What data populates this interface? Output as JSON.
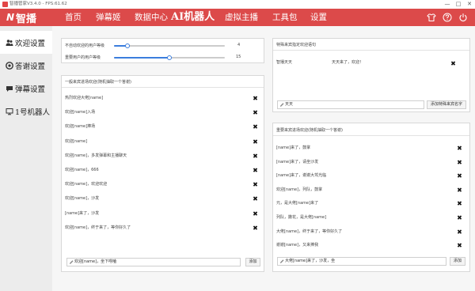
{
  "window": {
    "title": "智播管家V3.4.0 - FPS:61.62",
    "minimize_glyph": "—",
    "maximize_glyph": "□",
    "close_glyph": "✕"
  },
  "brand": {
    "mark": "N",
    "name": "智播"
  },
  "nav": {
    "items": [
      "首页",
      "弹幕姬",
      "数据中心",
      "AI机器人",
      "虚拟主播",
      "工具包",
      "设置"
    ],
    "icons": [
      "shirt-icon",
      "help-icon",
      "power-icon"
    ]
  },
  "sidebar": {
    "items": [
      {
        "label": "欢迎设置",
        "icon": "people-icon"
      },
      {
        "label": "答谢设置",
        "icon": "thanks-icon"
      },
      {
        "label": "弹幕设置",
        "icon": "barrage-icon"
      },
      {
        "label": "1号机器人",
        "icon": "monitor-icon"
      }
    ]
  },
  "settings": {
    "no_welcome_level_label": "不自动欢迎的用户等级",
    "no_welcome_level_value": "4",
    "no_welcome_level_fraction": 0.12,
    "vip_level_label": "重要用户的用户等级",
    "vip_level_value": "15",
    "vip_level_fraction": 0.5
  },
  "general_welcome": {
    "header": "一般来宾进场欢迎(随机抽取一个答谢)",
    "rows": [
      "热烈欢迎大佬[name]",
      "欢迎[name]入场",
      "欢迎[name]捧场",
      "欢迎[name]",
      "欢迎[name]，多发弹幕和主播聊天",
      "欢迎[name]，666",
      "欢迎[name]，欢迎欢迎",
      "欢迎[name]，沙发",
      "[name]来了，沙发",
      "欢迎[name]，终于来了，等你好久了"
    ],
    "input_value": "欢迎[name]，坐下唠嗑",
    "add_label": "添加"
  },
  "specific_welcome": {
    "header": "特殊来宾指定欢迎语句",
    "rows": [
      {
        "name": "智播天天",
        "text": "天天来了，欢迎！"
      }
    ],
    "input_value": "天天",
    "add_label": "添加特殊来宾名字"
  },
  "vip_welcome": {
    "header": "重要来宾进场欢迎(随机抽取一个答谢)",
    "rows": [
      "[name]来了，鼓掌",
      "[name]来了，请坐沙发",
      "[name]来了，谢谢大驾光临",
      "欢迎[name]，列队，鼓掌",
      "元，是大佬[name]来了",
      "列队，撒花，是大佬[name]",
      "大佬[name]，终于来了，等你好久了",
      "谢谢[name]，又来捧我"
    ],
    "input_value": "大佬[name]来了，沙发，坐",
    "add_label": "添加"
  }
}
